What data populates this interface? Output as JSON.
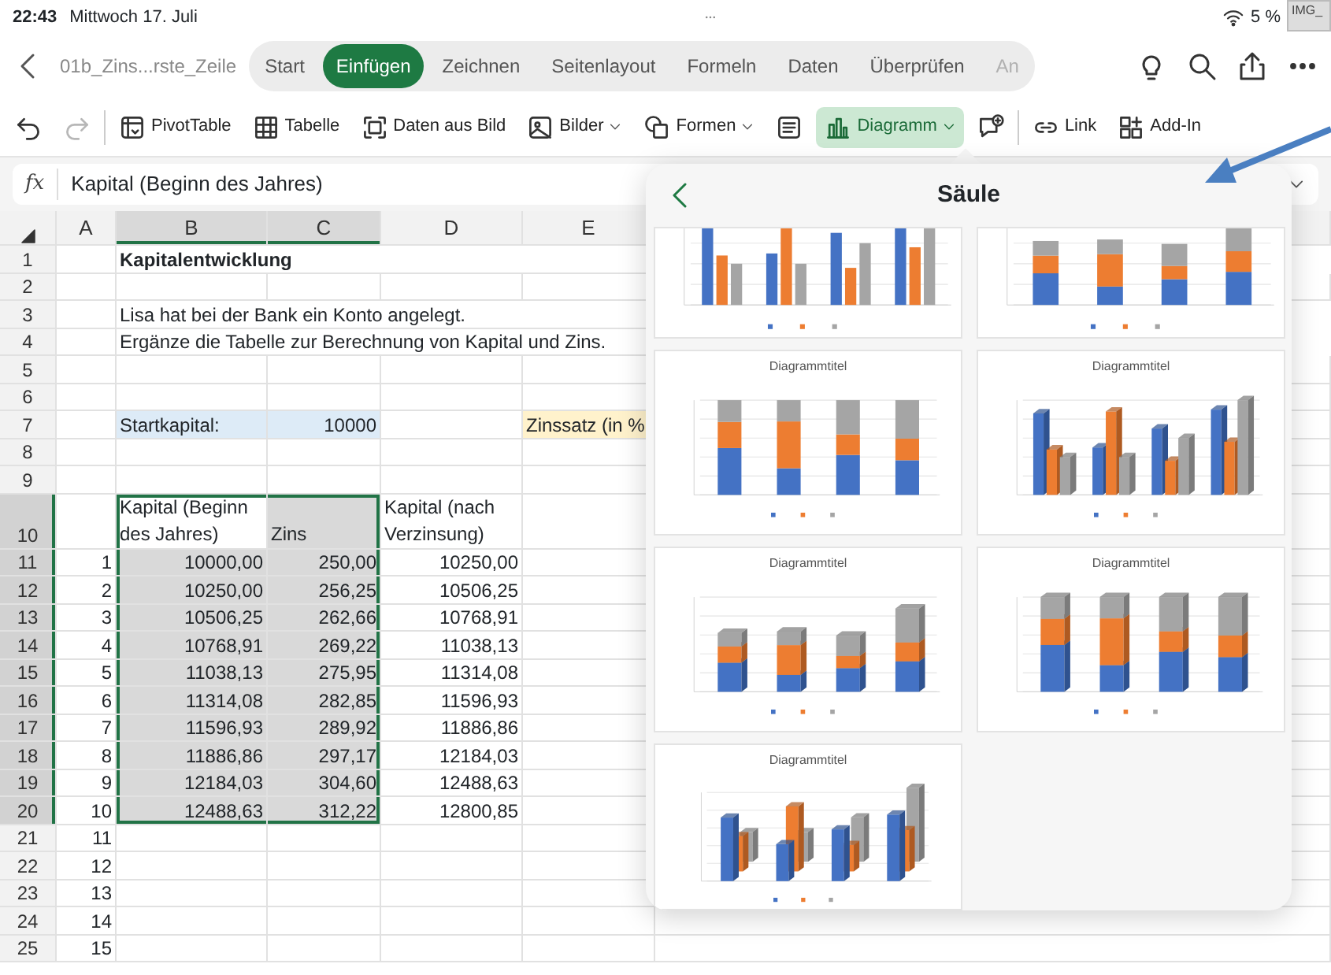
{
  "status_bar": {
    "time": "22:43",
    "date": "Mittwoch 17. Juli",
    "battery": "5 %",
    "screenshot_label": "IMG_"
  },
  "ribbon": {
    "file_name": "01b_Zins...rste_Zeile",
    "tabs": [
      {
        "label": "Start",
        "selected": false,
        "faded": false
      },
      {
        "label": "Einfügen",
        "selected": true,
        "faded": false
      },
      {
        "label": "Zeichnen",
        "selected": false,
        "faded": false
      },
      {
        "label": "Seitenlayout",
        "selected": false,
        "faded": false
      },
      {
        "label": "Formeln",
        "selected": false,
        "faded": false
      },
      {
        "label": "Daten",
        "selected": false,
        "faded": false
      },
      {
        "label": "Überprüfen",
        "selected": false,
        "faded": false
      },
      {
        "label": "An",
        "selected": false,
        "faded": true
      }
    ]
  },
  "toolbar": [
    {
      "kind": "undo",
      "disabled": false,
      "selected": false,
      "dropdown": false
    },
    {
      "kind": "redo",
      "disabled": true,
      "selected": false,
      "dropdown": false
    },
    {
      "kind": "separator"
    },
    {
      "kind": "pivot",
      "label": "PivotTable",
      "disabled": false,
      "selected": false,
      "dropdown": false
    },
    {
      "kind": "table",
      "label": "Tabelle",
      "disabled": false,
      "selected": false,
      "dropdown": false
    },
    {
      "kind": "scan",
      "label": "Daten aus Bild",
      "disabled": false,
      "selected": false,
      "dropdown": false
    },
    {
      "kind": "picture",
      "label": "Bilder",
      "disabled": false,
      "selected": false,
      "dropdown": true
    },
    {
      "kind": "shapes",
      "label": "Formen",
      "disabled": false,
      "selected": false,
      "dropdown": true
    },
    {
      "kind": "textbox",
      "disabled": false,
      "selected": false,
      "dropdown": false
    },
    {
      "kind": "chart",
      "label": "Diagramm",
      "disabled": false,
      "selected": true,
      "dropdown": true
    },
    {
      "kind": "comment",
      "disabled": false,
      "selected": false,
      "dropdown": false
    },
    {
      "kind": "separator"
    },
    {
      "kind": "link",
      "label": "Link",
      "disabled": false,
      "selected": false,
      "dropdown": false
    },
    {
      "kind": "addin",
      "label": "Add-In",
      "disabled": false,
      "selected": false,
      "dropdown": false
    }
  ],
  "formula_bar": {
    "label": "fx",
    "value": "Kapital (Beginn des Jahres)"
  },
  "sheet": {
    "columns": [
      {
        "letter": "A",
        "selected": false
      },
      {
        "letter": "B",
        "selected": true
      },
      {
        "letter": "C",
        "selected": true
      },
      {
        "letter": "D",
        "selected": false
      },
      {
        "letter": "E",
        "selected": false
      }
    ],
    "rows": [
      {
        "number": "1",
        "kind": "title",
        "selected": false,
        "cells": {
          "B": "Kapitalentwicklung"
        }
      },
      {
        "number": "2",
        "kind": "blank",
        "selected": false,
        "cells": {}
      },
      {
        "number": "3",
        "kind": "text",
        "selected": false,
        "cells": {
          "B": "Lisa hat bei der Bank ein Konto angelegt."
        }
      },
      {
        "number": "4",
        "kind": "text",
        "selected": false,
        "cells": {
          "B": "Ergänze die Tabelle zur Berechnung von Kapital und Zins."
        }
      },
      {
        "number": "5",
        "kind": "blank",
        "selected": false,
        "cells": {}
      },
      {
        "number": "6",
        "kind": "blank",
        "selected": false,
        "cells": {}
      },
      {
        "number": "7",
        "kind": "input",
        "selected": false,
        "cells": {
          "B": {
            "text": "Startkapital:",
            "color": "#ddebf7"
          },
          "C": {
            "text": "10000",
            "color": "#ddebf7"
          },
          "E": {
            "text": "Zinssatz (in %",
            "color": "#fff2cc"
          }
        }
      },
      {
        "number": "8",
        "kind": "blank",
        "selected": false,
        "cells": {}
      },
      {
        "number": "9",
        "kind": "blank",
        "selected": false,
        "cells": {}
      },
      {
        "number": "10",
        "kind": "header",
        "selected": true,
        "cells": {
          "B": {
            "text": "Kapital (Beginn des Jahres)",
            "active": true
          },
          "C": {
            "text": "Zins",
            "active": false
          },
          "D": "Kapital (nach Verzinsung)"
        }
      },
      {
        "number": "11",
        "kind": "data",
        "selected": true,
        "cells": {
          "A": "1",
          "B": "10000,00",
          "C": "250,00",
          "D": "10250,00"
        }
      },
      {
        "number": "12",
        "kind": "data",
        "selected": true,
        "cells": {
          "A": "2",
          "B": "10250,00",
          "C": "256,25",
          "D": "10506,25"
        }
      },
      {
        "number": "13",
        "kind": "data",
        "selected": true,
        "cells": {
          "A": "3",
          "B": "10506,25",
          "C": "262,66",
          "D": "10768,91"
        }
      },
      {
        "number": "14",
        "kind": "data",
        "selected": true,
        "cells": {
          "A": "4",
          "B": "10768,91",
          "C": "269,22",
          "D": "11038,13"
        }
      },
      {
        "number": "15",
        "kind": "data",
        "selected": true,
        "cells": {
          "A": "5",
          "B": "11038,13",
          "C": "275,95",
          "D": "11314,08"
        }
      },
      {
        "number": "16",
        "kind": "data",
        "selected": true,
        "cells": {
          "A": "6",
          "B": "11314,08",
          "C": "282,85",
          "D": "11596,93"
        }
      },
      {
        "number": "17",
        "kind": "data",
        "selected": true,
        "cells": {
          "A": "7",
          "B": "11596,93",
          "C": "289,92",
          "D": "11886,86"
        }
      },
      {
        "number": "18",
        "kind": "data",
        "selected": true,
        "cells": {
          "A": "8",
          "B": "11886,86",
          "C": "297,17",
          "D": "12184,03"
        }
      },
      {
        "number": "19",
        "kind": "data",
        "selected": true,
        "cells": {
          "A": "9",
          "B": "12184,03",
          "C": "304,60",
          "D": "12488,63"
        }
      },
      {
        "number": "20",
        "kind": "data",
        "selected": true,
        "cells": {
          "A": "10",
          "B": "12488,63",
          "C": "312,22",
          "D": "12800,85"
        }
      },
      {
        "number": "21",
        "kind": "data",
        "selected": false,
        "cells": {
          "A": "11"
        }
      },
      {
        "number": "22",
        "kind": "data",
        "selected": false,
        "cells": {
          "A": "12"
        }
      },
      {
        "number": "23",
        "kind": "data",
        "selected": false,
        "cells": {
          "A": "13"
        }
      },
      {
        "number": "24",
        "kind": "data",
        "selected": false,
        "cells": {
          "A": "14"
        }
      },
      {
        "number": "25",
        "kind": "data",
        "selected": false,
        "cells": {
          "A": "15"
        }
      }
    ]
  },
  "chart_panel": {
    "title": "Säule",
    "thumbnails": [
      {
        "kind": "clustered"
      },
      {
        "kind": "stacked"
      },
      {
        "kind": "percent",
        "title": "Diagrammtitel"
      },
      {
        "kind": "clustered3d",
        "title": "Diagrammtitel"
      },
      {
        "kind": "stacked3d",
        "title": "Diagrammtitel"
      },
      {
        "kind": "percent3d",
        "title": "Diagrammtitel"
      },
      {
        "kind": "column3d",
        "title": "Diagrammtitel"
      }
    ]
  }
}
